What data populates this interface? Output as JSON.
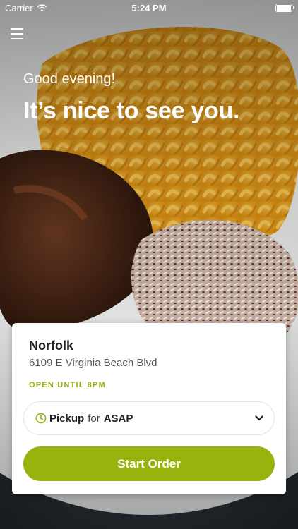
{
  "status_bar": {
    "carrier": "Carrier",
    "time": "5:24 PM"
  },
  "hero": {
    "greeting": "Good evening!",
    "headline": "It’s nice to see you."
  },
  "location": {
    "name": "Norfolk",
    "address": "6109 E Virginia Beach Blvd",
    "hours": "OPEN UNTIL 8PM"
  },
  "order_mode": {
    "mode": "Pickup",
    "connector": "for",
    "time": "ASAP"
  },
  "start_order_label": "Start Order",
  "colors": {
    "accent": "#98b20e",
    "card_background": "#ffffff"
  },
  "icons": {
    "menu": "hamburger-menu-icon",
    "clock": "clock-icon",
    "chevron": "chevron-down-icon",
    "wifi": "wifi-icon",
    "battery": "battery-icon"
  }
}
